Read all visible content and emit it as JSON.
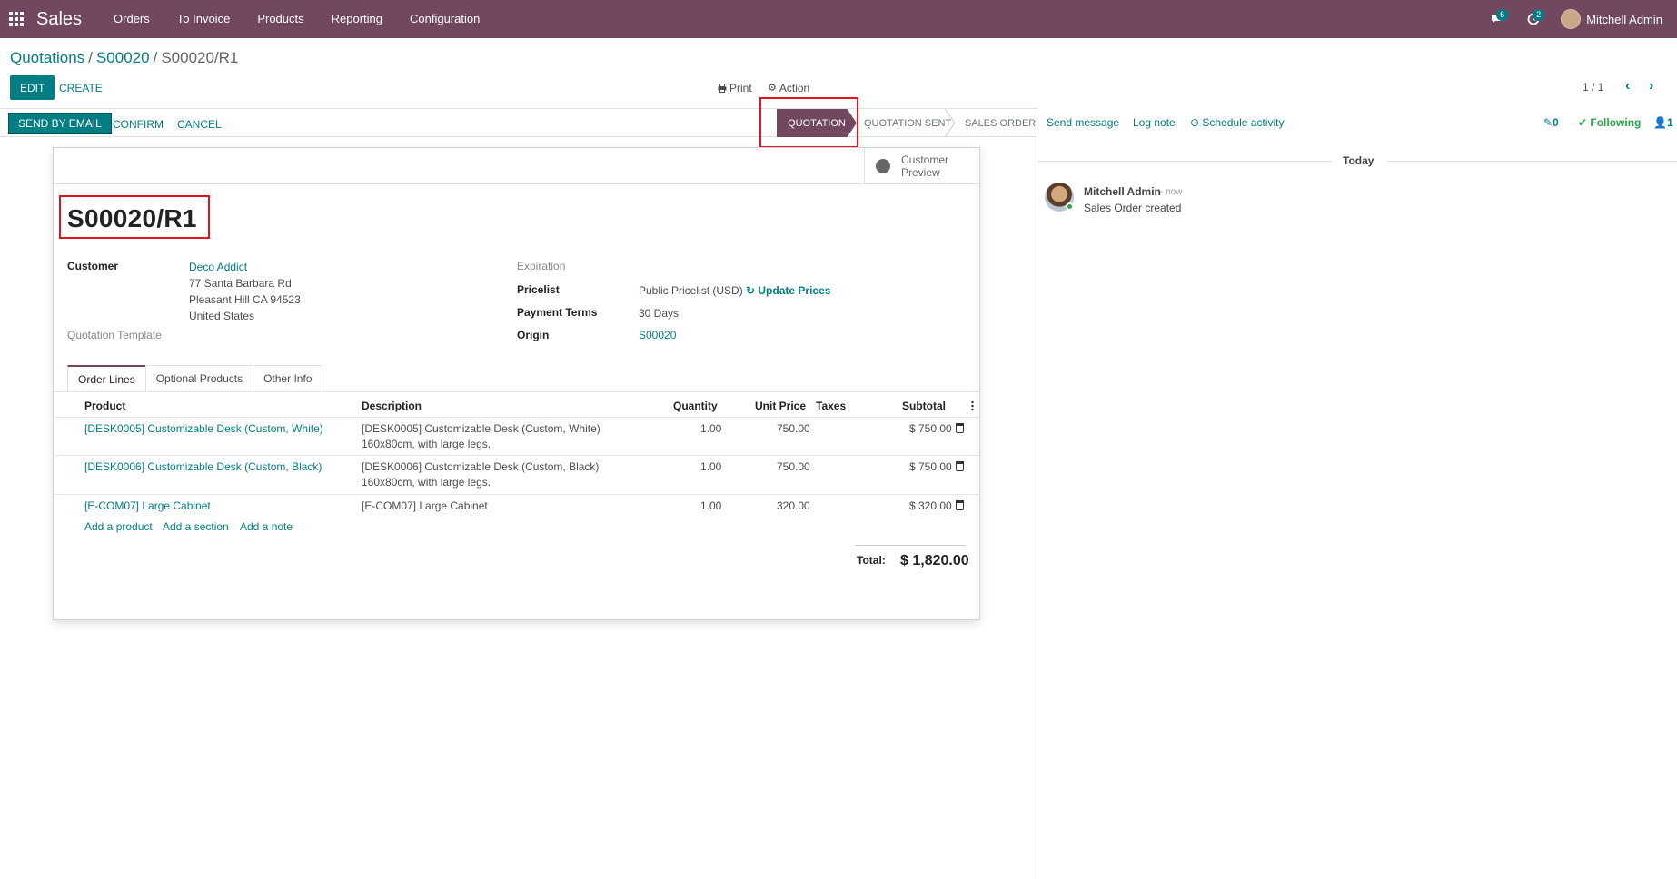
{
  "navbar": {
    "app_name": "Sales",
    "menu": [
      "Orders",
      "To Invoice",
      "Products",
      "Reporting",
      "Configuration"
    ],
    "messages_count": "6",
    "activities_count": "2",
    "user_name": "Mitchell Admin"
  },
  "breadcrumb": {
    "items": [
      "Quotations",
      "S00020"
    ],
    "current": "S00020/R1"
  },
  "control": {
    "edit_label": "EDIT",
    "create_label": "CREATE",
    "print_label": "Print",
    "action_label": "Action",
    "pager": "1 / 1"
  },
  "statusbar": {
    "send_email": "SEND BY EMAIL",
    "confirm": "CONFIRM",
    "cancel": "CANCEL",
    "stages": [
      "QUOTATION",
      "QUOTATION SENT",
      "SALES ORDER"
    ],
    "current_stage": "QUOTATION"
  },
  "form": {
    "preview_label_1": "Customer",
    "preview_label_2": "Preview",
    "title": "S00020/R1",
    "customer_label": "Customer",
    "customer_name": "Deco Addict",
    "address_line1": "77 Santa Barbara Rd",
    "address_line2": "Pleasant Hill CA 94523",
    "address_line3": "United States",
    "quotation_template_label": "Quotation Template",
    "expiration_label": "Expiration",
    "pricelist_label": "Pricelist",
    "pricelist_value": "Public Pricelist (USD)",
    "update_prices": "Update Prices",
    "payment_terms_label": "Payment Terms",
    "payment_terms_value": "30 Days",
    "origin_label": "Origin",
    "origin_value": "S00020"
  },
  "tabs": [
    "Order Lines",
    "Optional Products",
    "Other Info"
  ],
  "order_lines": {
    "columns": {
      "product": "Product",
      "description": "Description",
      "quantity": "Quantity",
      "unit_price": "Unit Price",
      "taxes": "Taxes",
      "subtotal": "Subtotal"
    },
    "rows": [
      {
        "product": "[DESK0005] Customizable Desk (Custom, White)",
        "description_1": "[DESK0005] Customizable Desk (Custom, White)",
        "description_2": "160x80cm, with large legs.",
        "quantity": "1.00",
        "unit_price": "750.00",
        "subtotal": "$ 750.00"
      },
      {
        "product": "[DESK0006] Customizable Desk (Custom, Black)",
        "description_1": "[DESK0006] Customizable Desk (Custom, Black)",
        "description_2": "160x80cm, with large legs.",
        "quantity": "1.00",
        "unit_price": "750.00",
        "subtotal": "$ 750.00"
      },
      {
        "product": "[E-COM07] Large Cabinet",
        "description_1": "[E-COM07] Large Cabinet",
        "description_2": "",
        "quantity": "1.00",
        "unit_price": "320.00",
        "subtotal": "$ 320.00"
      }
    ],
    "add_product": "Add a product",
    "add_section": "Add a section",
    "add_note": "Add a note",
    "total_label": "Total:",
    "total_value": "$ 1,820.00"
  },
  "chatter": {
    "send_message": "Send message",
    "log_note": "Log note",
    "schedule_activity": "Schedule activity",
    "attachments_count": "0",
    "following": "Following",
    "followers_count": "1",
    "date_separator": "Today",
    "message_author": "Mitchell Admin",
    "message_time": "- now",
    "message_body": "Sales Order created"
  },
  "colors": {
    "brand": "#71485f",
    "accent": "#017e84",
    "highlight": "#e0141e",
    "following": "#28a745"
  }
}
